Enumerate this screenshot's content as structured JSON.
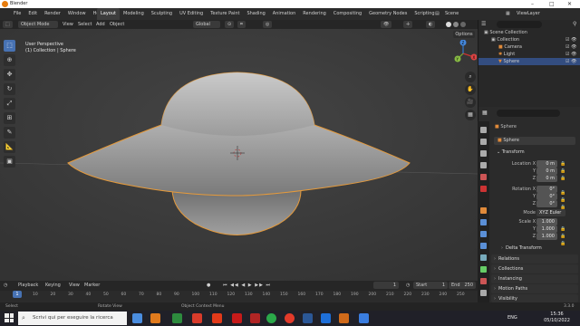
{
  "window": {
    "title": "Blender"
  },
  "menu": [
    "File",
    "Edit",
    "Render",
    "Window",
    "Help"
  ],
  "workspaces": [
    "Layout",
    "Modeling",
    "Sculpting",
    "UV Editing",
    "Texture Paint",
    "Shading",
    "Animation",
    "Rendering",
    "Compositing",
    "Geometry Nodes",
    "Scripting"
  ],
  "scene": "Scene",
  "view_layer": "ViewLayer",
  "viewport_header": {
    "mode": "Object Mode",
    "menus": [
      "View",
      "Select",
      "Add",
      "Object"
    ],
    "orientation": "Global"
  },
  "viewport": {
    "view_name": "User Perspective",
    "collection_label": "(1) Collection | Sphere",
    "options": "Options"
  },
  "gizmo": {
    "x": "X",
    "y": "Y",
    "z": "Z"
  },
  "timeline_header": {
    "items": [
      "Playback",
      "Keying",
      "View",
      "Marker"
    ],
    "current_frame": "1",
    "start_label": "Start",
    "start": "1",
    "end_label": "End",
    "end": "250"
  },
  "timeline_ticks": [
    "1",
    "10",
    "20",
    "30",
    "40",
    "50",
    "60",
    "70",
    "80",
    "90",
    "100",
    "110",
    "120",
    "130",
    "140",
    "150",
    "160",
    "170",
    "180",
    "190",
    "200",
    "210",
    "220",
    "230",
    "240",
    "250"
  ],
  "status": {
    "left": "Select",
    "mid": "Rotate View",
    "right": "Object Context Menu",
    "version": "3.3.0"
  },
  "taskbar": {
    "search_placeholder": "Scrivi qui per eseguire la ricerca",
    "language": "ENG",
    "time": "15:36",
    "date": "05/10/2022"
  },
  "outliner": {
    "root": "Scene Collection",
    "rows": [
      "Collection",
      "Camera",
      "Light",
      "Sphere"
    ]
  },
  "properties": {
    "object_name": "Sphere",
    "object_field": "Sphere",
    "transform_label": "Transform",
    "location_label": "Location X",
    "rotation_label": "Rotation X",
    "scale_label": "Scale X",
    "y": "Y",
    "z": "Z",
    "location": [
      "0 m",
      "0 m",
      "0 m"
    ],
    "rotation": [
      "0°",
      "0°",
      "0°"
    ],
    "mode_label": "Mode",
    "mode": "XYZ Euler",
    "scale": [
      "1.000",
      "1.000",
      "1.000"
    ],
    "panels": [
      "Delta Transform",
      "Relations",
      "Collections",
      "Instancing",
      "Motion Paths",
      "Visibility"
    ]
  }
}
